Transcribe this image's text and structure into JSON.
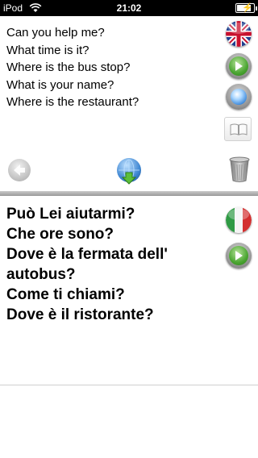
{
  "status_bar": {
    "carrier": "iPod",
    "time": "21:02",
    "battery_level": 0.85
  },
  "source": {
    "language_icon": "uk-flag-icon",
    "lines": [
      "Can you help me?",
      "What time is it?",
      "Where is the bus stop?",
      "What is your name?",
      "Where is the restaurant?"
    ]
  },
  "target": {
    "language_icon": "italy-flag-icon",
    "lines": [
      "Può Lei aiutarmi?",
      "Che ore sono?",
      "Dove è la fermata dell'",
      "autobus?",
      "Come ti chiami?",
      "Dove è il ristorante?"
    ]
  },
  "colors": {
    "divider": "#9a9a9a",
    "play_green": "#4aa531",
    "record_blue": "#2f7fd6"
  }
}
